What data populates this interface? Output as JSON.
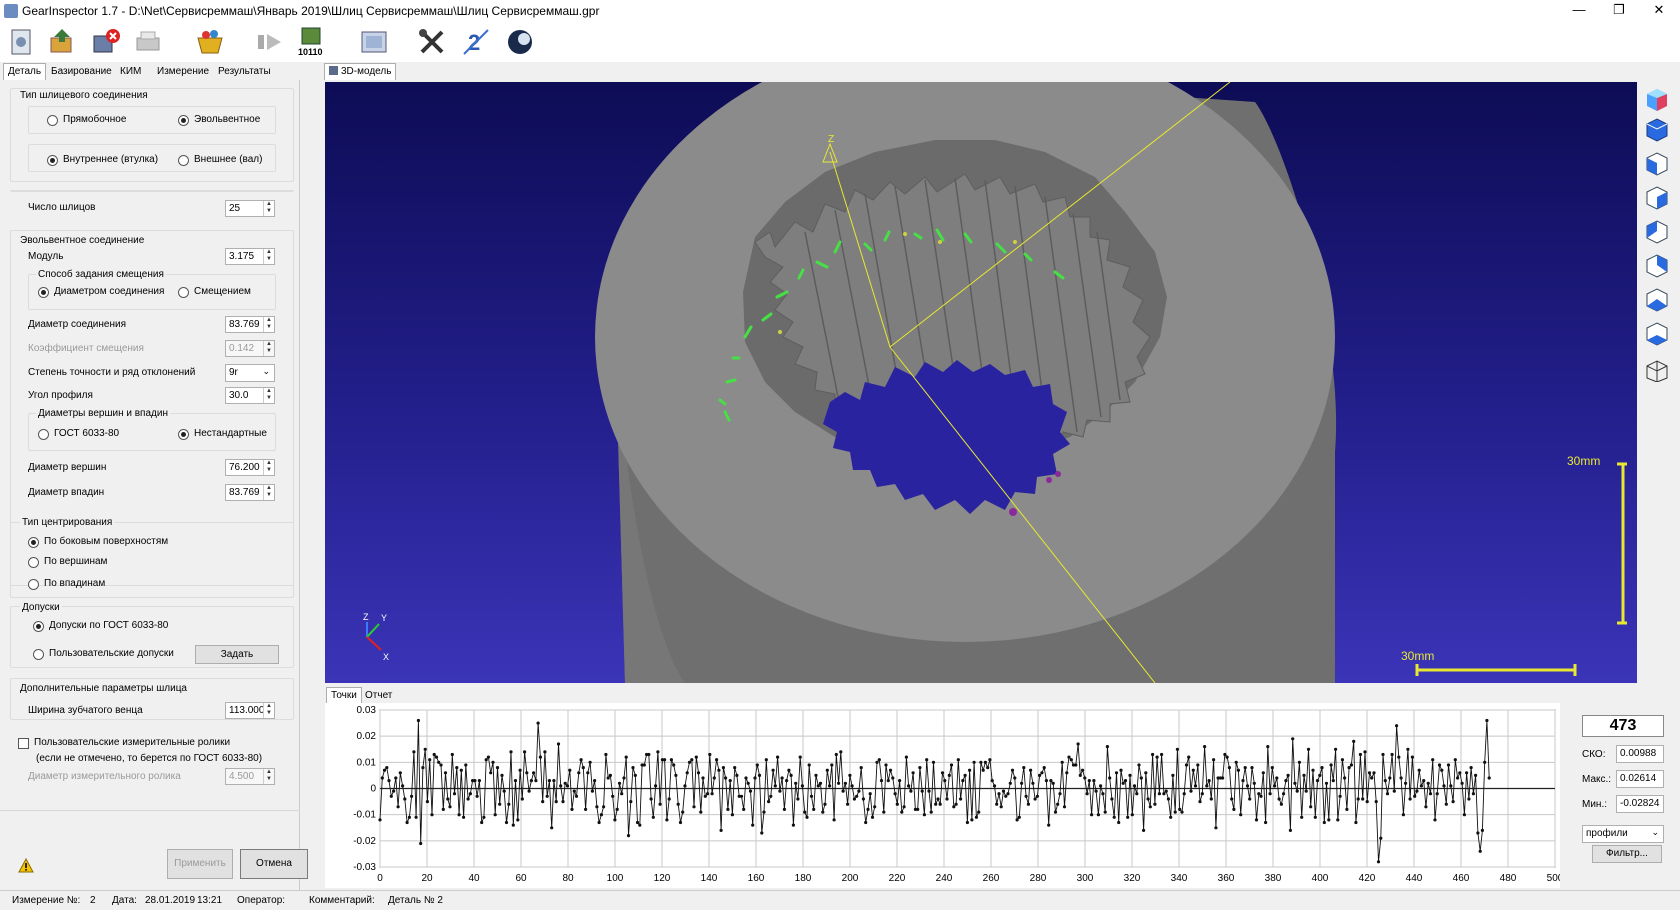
{
  "window": {
    "title": "GearInspector 1.7 - D:\\Net\\Сервисреммаш\\Январь 2019\\Шлиц Сервисреммаш\\Шлиц Сервисреммаш.gpr",
    "minimize": "—",
    "maximize": "❐",
    "close": "✕"
  },
  "toolbar": {
    "icons": [
      "gear-open-icon",
      "gear-save-icon",
      "gear-close-icon",
      "printer-icon",
      "basket-icon",
      "step-forward-icon",
      "binary-data-icon",
      "image-view-icon",
      "tools-icon",
      "font-size-icon",
      "sphere-icon"
    ],
    "binary_label": "10110"
  },
  "left_tabs": [
    "Деталь",
    "Базирование",
    "КИМ",
    "Измерение",
    "Результаты"
  ],
  "spline_type": {
    "title": "Тип шлицевого соединения",
    "straight": "Прямобочное",
    "involute": "Эвольвентное",
    "internal": "Внутреннее (втулка)",
    "external": "Внешнее (вал)"
  },
  "spline_count": {
    "label": "Число шлицов",
    "value": "25"
  },
  "involute": {
    "title": "Эвольвентное соединение",
    "module_label": "Модуль",
    "module_value": "3.175",
    "offset_title": "Способ задания смещения",
    "by_diameter": "Диаметром соединения",
    "by_offset": "Смещением",
    "diameter_label": "Диаметр соединения",
    "diameter_value": "83.769",
    "coef_label": "Коэффициент смещения",
    "coef_value": "0.142",
    "accuracy_label": "Степень точности и ряд отклонений",
    "accuracy_value": "9r",
    "angle_label": "Угол профиля",
    "angle_value": "30.0",
    "tips_title": "Диаметры вершин и впадин",
    "gost": "ГОСТ 6033-80",
    "custom": "Нестандартные",
    "tip_label": "Диаметр вершин",
    "tip_value": "76.200",
    "root_label": "Диаметр впадин",
    "root_value": "83.769"
  },
  "centering": {
    "title": "Тип центрирования",
    "sides": "По боковым поверхностям",
    "tips": "По вершинам",
    "roots": "По впадинам"
  },
  "tolerances": {
    "title": "Допуски",
    "gost": "Допуски по ГОСТ 6033-80",
    "user": "Пользовательские допуски",
    "set_button": "Задать"
  },
  "extra": {
    "title": "Дополнительные параметры шлица",
    "width_label": "Ширина зубчатого венца",
    "width_value": "113.000"
  },
  "rollers": {
    "label": "Пользовательские измерительные ролики",
    "note": "(если не отмечено, то берется по ГОСТ 6033-80)",
    "diameter_label": "Диаметр измерительного ролика",
    "diameter_value": "4.500"
  },
  "actions": {
    "apply": "Применить",
    "cancel": "Отмена"
  },
  "view_tab": "3D-модель",
  "scale": {
    "vertical": "30mm",
    "horizontal": "30mm"
  },
  "axes": {
    "x": "X",
    "y": "Y",
    "z": "Z"
  },
  "bottom_tabs": [
    "Точки",
    "Отчет"
  ],
  "stats": {
    "count": "473",
    "sko_label": "СКО:",
    "sko_value": "0.00988",
    "max_label": "Макс.:",
    "max_value": "0.02614",
    "min_label": "Мин.:",
    "min_value": "-0.02824",
    "mode": "профили",
    "filter": "Фильтр..."
  },
  "status": {
    "measurement": "Измерение №:",
    "measurement_no": "2",
    "date_label": "Дата:",
    "date": "28.01.2019",
    "time": "13:21",
    "operator": "Оператор:",
    "comment_label": "Комментарий:",
    "comment": "Деталь № 2"
  },
  "chart_data": {
    "type": "line",
    "xlim": [
      0,
      500
    ],
    "ylim": [
      -0.03,
      0.03
    ],
    "x_ticks": [
      0,
      20,
      40,
      60,
      80,
      100,
      120,
      140,
      160,
      180,
      200,
      220,
      240,
      260,
      280,
      300,
      320,
      340,
      360,
      380,
      400,
      420,
      440,
      460,
      480,
      500
    ],
    "y_ticks": [
      "0.03",
      "0.02",
      "0.01",
      "0",
      "-0.01",
      "-0.02",
      "-0.03"
    ],
    "y_tick_values": [
      0.03,
      0.02,
      0.01,
      0,
      -0.01,
      -0.02,
      -0.03
    ],
    "grid": true,
    "markers": true,
    "n_points": 473,
    "y_max": 0.02614,
    "y_min": -0.02824,
    "series": [
      {
        "values": [
          -0.012,
          0.004,
          0.007,
          0.008,
          0.003,
          -0.003,
          -0.001,
          0.004,
          -0.007,
          0.006,
          0.001,
          -0.004,
          -0.013,
          -0.011,
          -0.003,
          0.014,
          -0.011,
          0.026,
          -0.021,
          0.008,
          0.015,
          -0.005,
          0.011,
          -0.01,
          0.013,
          0.012,
          0.01,
          0.009,
          -0.008,
          0.006,
          -0.004,
          -0.007,
          0.013,
          -0.002,
          0.008,
          -0.01,
          0.007,
          -0.011,
          0.009,
          -0.004,
          -0.002,
          0.003,
          0.003,
          -0.003,
          0.003,
          -0.013,
          -0.011,
          0.011,
          0.012,
          0.006,
          0.01,
          -0.01,
          0.008,
          -0.006,
          0.005,
          -0.001,
          -0.013,
          -0.006,
          0.014,
          -0.014,
          0.003,
          -0.012,
          0.007,
          -0.004,
          0.014,
          0.006,
          -0.001,
          0.003,
          0.006,
          0.003,
          0.025,
          0.012,
          -0.005,
          0.014,
          -0.003,
          0.003,
          -0.015,
          0.003,
          -0.005,
          0.017,
          0.001,
          -0.005,
          0.002,
          0.001,
          0.007,
          -0.008,
          -0.001,
          -0.003,
          0.006,
          0.011,
          0.008,
          -0.008,
          0.006,
          0.01,
          -0.001,
          0.003,
          -0.007,
          -0.013,
          -0.01,
          -0.007,
          0.013,
          0.004,
          0.005,
          -0.003,
          -0.012,
          -0.008,
          0.002,
          -0.002,
          0.004,
          0.012,
          -0.018,
          -0.005,
          0.008,
          0.005,
          -0.013,
          -0.014,
          0.009,
          0.009,
          0.013,
          0.013,
          -0.004,
          -0.011,
          0.001,
          0.014,
          -0.006,
          0.011,
          0.011,
          -0.012,
          -0.004,
          0.011,
          0.009,
          0.005,
          -0.006,
          -0.013,
          -0.009,
          0.001,
          0.006,
          0.01,
          0.011,
          -0.007,
          0.012,
          0.006,
          -0.009,
          0.004,
          -0.003,
          -0.002,
          0.013,
          -0.002,
          0.004,
          0.011,
          0.007,
          -0.016,
          0.008,
          0.004,
          -0.008,
          0.003,
          -0.01,
          0.008,
          0.005,
          -0.003,
          -0.003,
          -0.008,
          0.004,
          0.002,
          -0.001,
          -0.014,
          0.004,
          0.009,
          0.005,
          -0.017,
          -0.009,
          0.011,
          -0.005,
          -0.003,
          0.007,
          0.001,
          0.012,
          -0.001,
          0.004,
          -0.008,
          0.003,
          0.007,
          0.005,
          -0.014,
          0.002,
          -0.004,
          0.012,
          0.001,
          -0.009,
          -0.011,
          0.009,
          -0.003,
          -0.008,
          0.005,
          0.001,
          0.002,
          -0.009,
          -0.006,
          0.007,
          0.001,
          0.009,
          -0.012,
          0.013,
          0.002,
          0.014,
          -0.001,
          0.002,
          -0.006,
          0.005,
          0.001,
          -0.004,
          -0.003,
          -0.001,
          0.008,
          -0.004,
          -0.013,
          -0.008,
          -0.002,
          -0.011,
          -0.007,
          0.01,
          0.011,
          0.003,
          -0.009,
          0.009,
          0.003,
          0.007,
          0.004,
          -0.002,
          -0.006,
          0.003,
          -0.009,
          -0.007,
          0.012,
          0.001,
          -0.001,
          0.006,
          -0.008,
          -0.008,
          0.008,
          -0.001,
          -0.01,
          0.011,
          -0.001,
          -0.009,
          0.01,
          -0.006,
          -0.004,
          -0.006,
          0.006,
          0.003,
          -0.004,
          0.005,
          0.009,
          -0.007,
          -0.006,
          0.011,
          -0.004,
          0.003,
          0.005,
          -0.013,
          0.007,
          -0.012,
          0.01,
          -0.011,
          -0.009,
          0.01,
          0.007,
          0.01,
          0.008,
          0.011,
          0.003,
          0.001,
          -0.006,
          -0.002,
          -0.007,
          -0.001,
          -0.003,
          -0.002,
          0.002,
          0.007,
          0.004,
          -0.012,
          -0.011,
          0.002,
          0.008,
          -0.003,
          -0.006,
          0.007,
          0.002,
          -0.004,
          -0.003,
          0.005,
          0.006,
          0.008,
          0.003,
          -0.014,
          0.003,
          0.002,
          -0.009,
          -0.006,
          -0.002,
          0.01,
          -0.007,
          0.006,
          0.012,
          0.011,
          0.009,
          0.009,
          0.017,
          0.005,
          0.007,
          0.004,
          -0.002,
          0.003,
          -0.01,
          0.003,
          -0.001,
          -0.01,
          0.001,
          -0.002,
          -0.009,
          0.016,
          0.004,
          -0.004,
          -0.011,
          0.006,
          -0.013,
          0.007,
          0.002,
          0.003,
          -0.011,
          0.005,
          -0.01,
          0.001,
          -0.002,
          0.009,
          0.004,
          -0.016,
          0.006,
          -0.004,
          -0.007,
          0.013,
          -0.006,
          0.012,
          -0.002,
          0.013,
          -0.002,
          -0.001,
          -0.004,
          -0.011,
          0.005,
          -0.009,
          0.015,
          -0.008,
          -0.009,
          -0.002,
          0.009,
          0.012,
          -0.001,
          0.007,
          0.001,
          0.009,
          -0.005,
          -0.002,
          0.016,
          0.001,
          0.003,
          -0.004,
          0.011,
          -0.015,
          0.004,
          0.004,
          0.004,
          0.013,
          0.012,
          0.008,
          -0.004,
          -0.008,
          0.01,
          0.007,
          -0.01,
          0.003,
          0.008,
          0.001,
          -0.004,
          0.008,
          0.002,
          -0.012,
          -0.002,
          -0.003,
          0.006,
          -0.013,
          0.016,
          -0.002,
          0.008,
          0.001,
          0.004,
          -0.004,
          -0.006,
          -0.002,
          0.003,
          0.005,
          -0.016,
          0.019,
          0.002,
          -0.001,
          0.01,
          -0.011,
          0.005,
          -0.001,
          0.015,
          -0.007,
          0.007,
          -0.011,
          0.003,
          0.005,
          0.008,
          -0.013,
          0.002,
          -0.012,
          0.009,
          0.003,
          0.015,
          -0.012,
          -0.003,
          0.011,
          0.004,
          -0.008,
          0.008,
          0.009,
          0.018,
          -0.013,
          -0.004,
          0.013,
          -0.004,
          0.014,
          -0.005,
          0.006,
          0.004,
          0.006,
          -0.005,
          -0.028,
          -0.019,
          0.013,
          0.003,
          -0.002,
          0.004,
          0.013,
          -0.001,
          0.024,
          0.012,
          0.004,
          -0.01,
          0.002,
          0.015,
          -0.004,
          0.012,
          -0.003,
          -0.001,
          0.007,
          0.001,
          0.003,
          -0.007,
          0.002,
          -0.002,
          0.011,
          -0.012,
          -0.002,
          0.009,
          0.007,
          0.001,
          -0.006,
          0.009,
          0.001,
          -0.005,
          0.011,
          0.004,
          0.006,
          0.002,
          -0.01,
          0.006,
          -0.004,
          0.008,
          -0.002,
          0.005,
          -0.017,
          -0.024,
          -0.016,
          0.01,
          0.026,
          0.004
        ]
      }
    ]
  }
}
